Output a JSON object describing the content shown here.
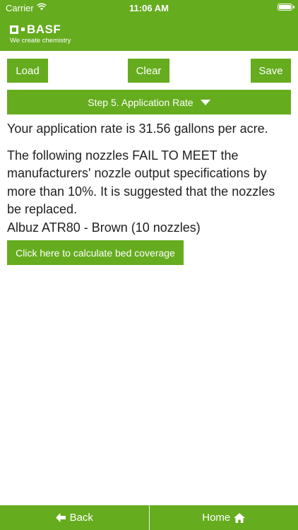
{
  "status_bar": {
    "carrier": "Carrier",
    "time": "11:06 AM"
  },
  "brand": {
    "name": "BASF",
    "tagline": "We create chemistry",
    "color": "#65ac1e"
  },
  "toolbar": {
    "load_label": "Load",
    "clear_label": "Clear",
    "save_label": "Save"
  },
  "step_selector": {
    "label": "Step 5. Application Rate",
    "icon": "caret-down-icon"
  },
  "result": {
    "prefix": "Your application rate is",
    "value": "31.56",
    "suffix": "gallons per acre.",
    "warning": "The following nozzles FAIL TO MEET the manufacturers' nozzle output specifications by more than 10%. It is suggested that the nozzles be replaced.",
    "nozzle": "Albuz ATR80 - Brown (10 nozzles)"
  },
  "bed_coverage_button": {
    "label": "Click here to calculate bed coverage"
  },
  "bottom_nav": {
    "back_label": "Back",
    "home_label": "Home",
    "back_icon": "arrow-left-icon",
    "home_icon": "home-icon"
  }
}
